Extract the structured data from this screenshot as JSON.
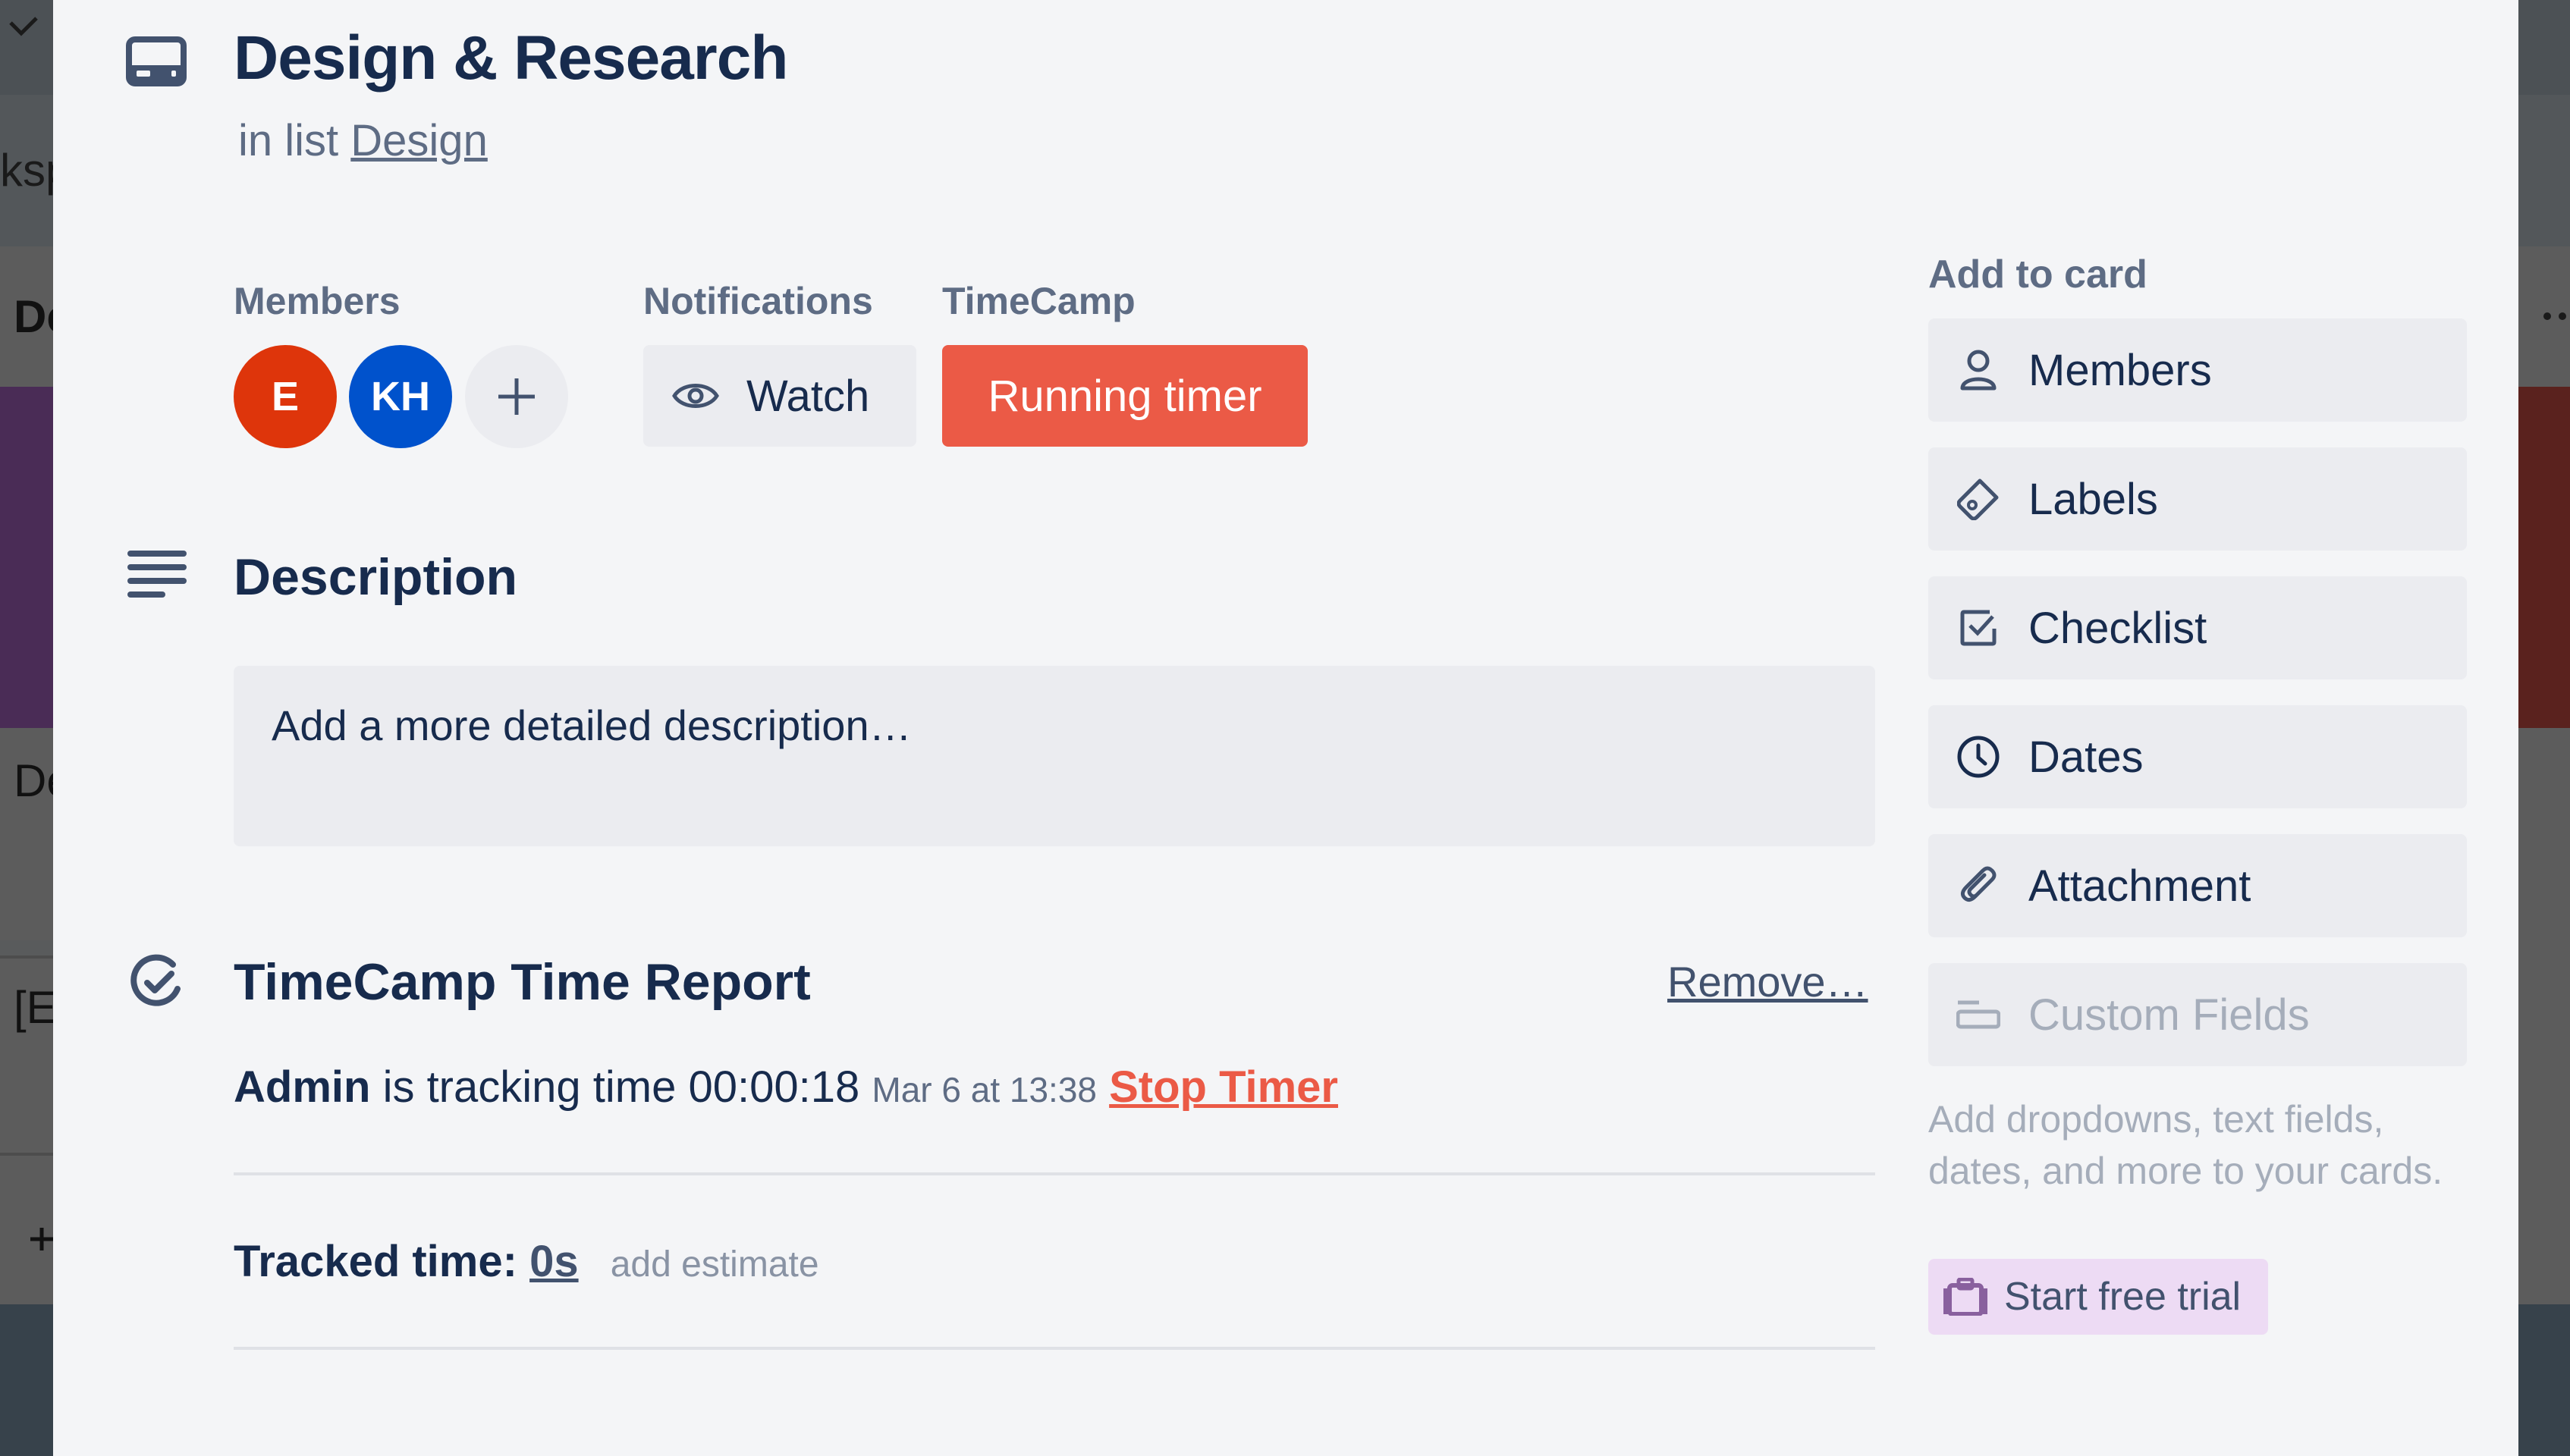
{
  "card": {
    "title": "Design & Research",
    "list_prefix": "in list",
    "list_name": "Design"
  },
  "members_section": {
    "label": "Members",
    "avatars": [
      {
        "initials": "E",
        "color": "#de350b"
      },
      {
        "initials": "KH",
        "color": "#0052cc"
      }
    ],
    "add_label": "+"
  },
  "notifications_section": {
    "label": "Notifications",
    "watch_label": "Watch"
  },
  "timecamp_section": {
    "label": "TimeCamp",
    "running_timer_label": "Running timer",
    "accent": "#eb5a46"
  },
  "description": {
    "heading": "Description",
    "placeholder": "Add a more detailed description…"
  },
  "time_report": {
    "heading": "TimeCamp Time Report",
    "remove_label": "Remove…",
    "user": "Admin",
    "tracking_text": "is tracking time",
    "elapsed": "00:00:18",
    "started": "Mar 6 at 13:38",
    "stop_label": "Stop Timer",
    "tracked_label": "Tracked time:",
    "tracked_value": "0s",
    "add_estimate_label": "add estimate"
  },
  "sidebar": {
    "heading": "Add to card",
    "items": [
      {
        "label": "Members",
        "icon": "person-icon"
      },
      {
        "label": "Labels",
        "icon": "tag-icon"
      },
      {
        "label": "Checklist",
        "icon": "checkbox-icon"
      },
      {
        "label": "Dates",
        "icon": "clock-icon"
      },
      {
        "label": "Attachment",
        "icon": "paperclip-icon"
      },
      {
        "label": "Custom Fields",
        "icon": "custom-fields-icon",
        "disabled": true
      }
    ],
    "custom_fields_info": "Add dropdowns, text fields, dates, and more to your cards.",
    "trial_label": "Start free trial"
  },
  "background": {
    "left_fragments": [
      "ksp",
      "De",
      "De",
      "[E"
    ],
    "left_card_color": "#4a2c56",
    "right_card_color": "#5a221e"
  }
}
